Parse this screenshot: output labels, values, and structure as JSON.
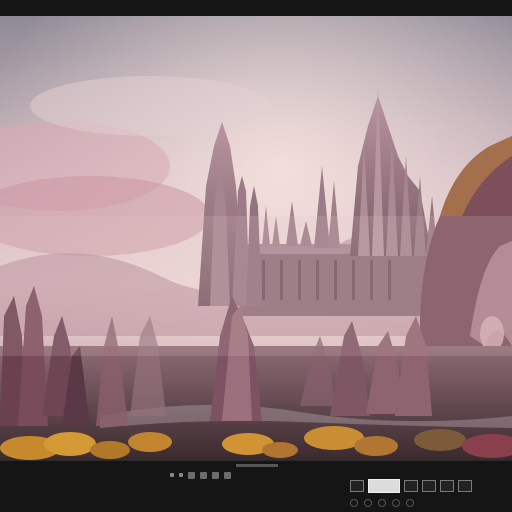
{
  "window": {
    "caption": "",
    "status": ""
  },
  "scene": {
    "subject": "fantasy-castle-landscape-image",
    "colors": {
      "sky_top": "#9c8f99",
      "sky_glow": "#e6c9c9",
      "castle": "#a1808c",
      "castle_shadow": "#6e5560",
      "rock": "#8a5f6b",
      "rock_dark": "#4a3038",
      "foliage": "#c88a2a",
      "ground": "#5b4c4c"
    }
  },
  "controls": {
    "icons": [
      "prev-icon",
      "play-icon",
      "next-icon",
      "grid-icon",
      "settings-icon",
      "info-icon"
    ]
  }
}
